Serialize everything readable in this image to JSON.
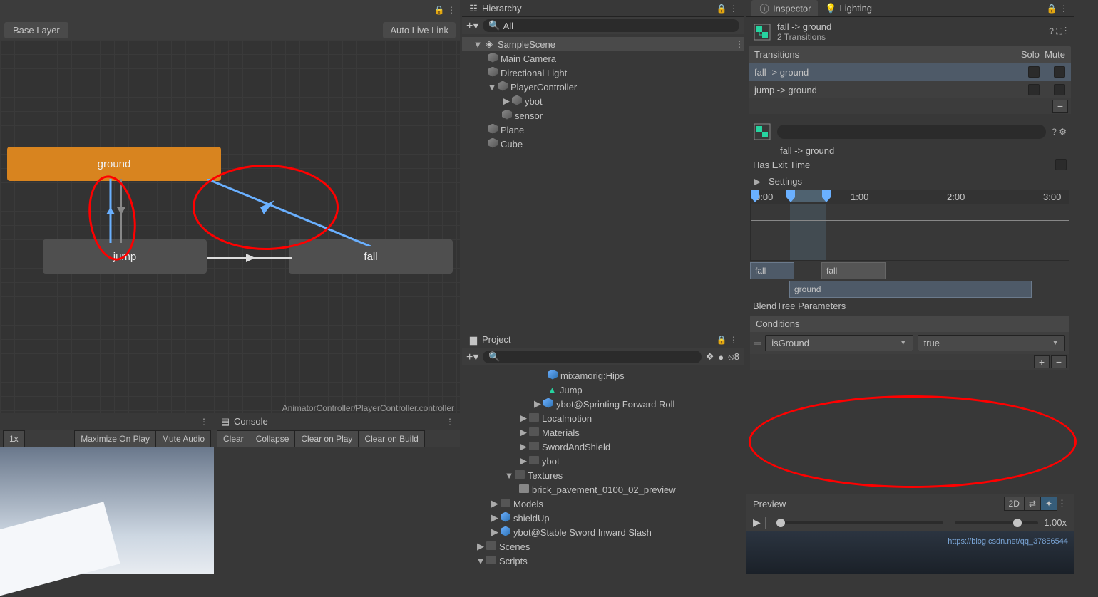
{
  "animator": {
    "breadcrumb": "Base Layer",
    "live_link": "Auto Live Link",
    "nodes": {
      "ground": "ground",
      "jump": "jump",
      "fall": "fall"
    },
    "footer": "AnimatorController/PlayerController.controller"
  },
  "game": {
    "scale": "1x",
    "maximize": "Maximize On Play",
    "mute": "Mute Audio"
  },
  "console": {
    "title": "Console",
    "clear": "Clear",
    "collapse": "Collapse",
    "clear_play": "Clear on Play",
    "clear_build": "Clear on Build"
  },
  "hierarchy": {
    "title": "Hierarchy",
    "search": "All",
    "scene": "SampleScene",
    "items": {
      "camera": "Main Camera",
      "light": "Directional Light",
      "player": "PlayerController",
      "ybot": "ybot",
      "sensor": "sensor",
      "plane": "Plane",
      "cube": "Cube"
    }
  },
  "project": {
    "title": "Project",
    "hidden": "8",
    "items": {
      "hips": "mixamorig:Hips",
      "jump": "Jump",
      "roll": "ybot@Sprinting Forward Roll",
      "loco": "Localmotion",
      "mat": "Materials",
      "sword": "SwordAndShield",
      "ybot": "ybot",
      "tex": "Textures",
      "brick": "brick_pavement_0100_02_preview",
      "models": "Models",
      "shield": "shieldUp",
      "stab": "ybot@Stable Sword Inward Slash",
      "scenes": "Scenes",
      "scripts": "Scripts"
    }
  },
  "inspector": {
    "tab1": "Inspector",
    "tab2": "Lighting",
    "name": "fall -> ground",
    "count": "2 Transitions",
    "list_head": "Transitions",
    "solo": "Solo",
    "mute": "Mute",
    "t1": "fall -> ground",
    "t2": "jump -> ground",
    "sub_name": "fall -> ground",
    "exit": "Has Exit Time",
    "settings": "Settings",
    "timeline": {
      "t0": "0:00",
      "t1": "1:00",
      "t2": "2:00",
      "t3": "3:00",
      "clip1": "fall",
      "clip2": "fall",
      "clip3": "ground"
    },
    "blend": "BlendTree Parameters",
    "cond_head": "Conditions",
    "cond_param": "isGround",
    "cond_val": "true",
    "preview": "Preview",
    "two_d": "2D",
    "speed": "1.00x"
  },
  "watermark": "https://blog.csdn.net/qq_37856544"
}
